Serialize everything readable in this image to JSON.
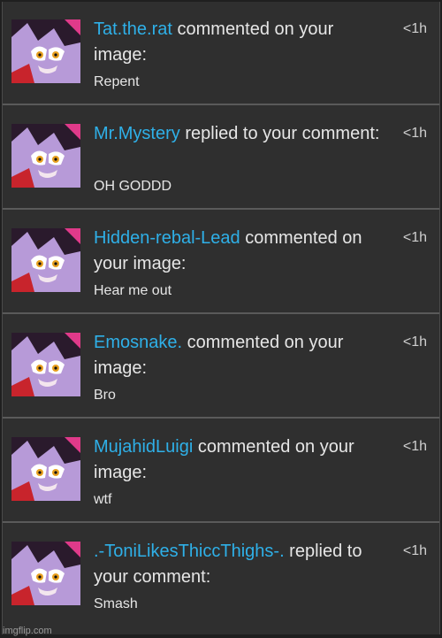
{
  "notifications": [
    {
      "user": "Tat.the.rat",
      "action": " commented on your image:",
      "text": "Repent",
      "time": "<1h",
      "avatar_icon": "cat-avatar-icon"
    },
    {
      "user": "Mr.Mystery",
      "action": " replied to your comment:",
      "text": "OH GODDD",
      "time": "<1h",
      "avatar_icon": "cat-avatar-icon"
    },
    {
      "user": "Hidden-rebal-Lead",
      "action": " commented on your image:",
      "text": "Hear me out",
      "time": "<1h",
      "avatar_icon": "cat-avatar-icon"
    },
    {
      "user": "Emosnake.",
      "action": " commented on your image:",
      "text": "Bro",
      "time": "<1h",
      "avatar_icon": "cat-avatar-icon"
    },
    {
      "user": "MujahidLuigi",
      "action": " commented on your image:",
      "text": "wtf",
      "time": "<1h",
      "avatar_icon": "cat-avatar-icon"
    },
    {
      "user": ".-ToniLikesThiccThighs-.",
      "action": " replied to your comment:",
      "text": "Smash",
      "time": "<1h",
      "avatar_icon": "cat-avatar-icon"
    }
  ],
  "watermark": "imgflip.com",
  "colors": {
    "username": "#2fb0e8",
    "row_background": "#2f2f2f",
    "separator": "#5a5a5a",
    "text": "#e6e6e6"
  }
}
